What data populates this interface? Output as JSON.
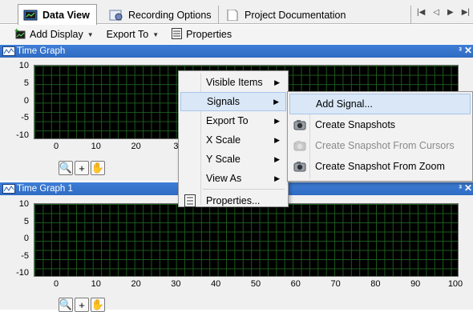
{
  "tabs": [
    {
      "label": "Data View",
      "icon": "data-view-icon",
      "active": true
    },
    {
      "label": "Recording Options",
      "icon": "recording-options-icon",
      "active": false
    },
    {
      "label": "Project Documentation",
      "icon": "document-icon",
      "active": false
    }
  ],
  "toolbar": {
    "add_display": "Add Display",
    "export_to": "Export To",
    "properties": "Properties"
  },
  "panels": [
    {
      "title": "Time Graph",
      "y_ticks": [
        "10",
        "5",
        "0",
        "-5",
        "-10"
      ],
      "x_ticks": [
        "0",
        "10",
        "20",
        "3"
      ]
    },
    {
      "title": "Time Graph 1",
      "y_ticks": [
        "10",
        "5",
        "0",
        "-5",
        "-10"
      ],
      "x_ticks": [
        "0",
        "10",
        "20",
        "30",
        "40",
        "50",
        "60",
        "70",
        "80",
        "90",
        "100"
      ]
    }
  ],
  "context_menu": {
    "items": [
      {
        "label": "Visible Items",
        "submenu": true
      },
      {
        "label": "Signals",
        "submenu": true,
        "highlighted": true
      },
      {
        "label": "Export To",
        "submenu": true
      },
      {
        "label": "X Scale",
        "submenu": true
      },
      {
        "label": "Y Scale",
        "submenu": true
      },
      {
        "label": "View As",
        "submenu": true
      },
      {
        "label": "Properties...",
        "submenu": false,
        "icon": "properties-icon"
      }
    ]
  },
  "submenu": {
    "items": [
      {
        "label": "Add Signal...",
        "highlighted": true
      },
      {
        "label": "Create Snapshots",
        "icon": "camera-icon"
      },
      {
        "label": "Create Snapshot From Cursors",
        "icon": "camera-icon",
        "disabled": true
      },
      {
        "label": "Create Snapshot From Zoom",
        "icon": "camera-icon"
      }
    ]
  },
  "colors": {
    "panel_title": "#2f6bc3",
    "plot_bg": "#000000",
    "grid": "#1c5a1c",
    "menu_highlight": "#d9e7f7"
  }
}
